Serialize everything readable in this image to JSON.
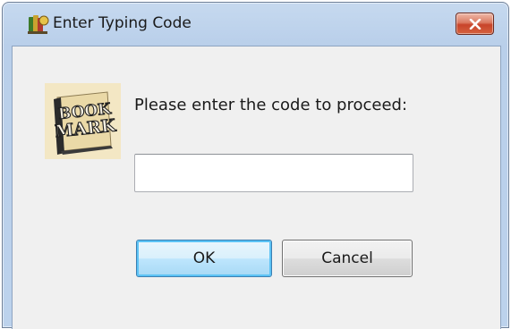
{
  "window": {
    "title": "Enter Typing Code",
    "icon": "bookmark-app-icon",
    "close_icon": "close-icon"
  },
  "dialog": {
    "logo": {
      "icon": "bookmark-book-logo",
      "text_line1": "BOOK",
      "text_line2": "MARK"
    },
    "prompt": "Please enter the code to proceed:",
    "code_input": {
      "value": "",
      "placeholder": ""
    },
    "ok_label": "OK",
    "cancel_label": "Cancel"
  },
  "colors": {
    "ok_border": "#3c7fb1",
    "close_red": "#c8442a",
    "client_bg": "#f0f0f0"
  }
}
